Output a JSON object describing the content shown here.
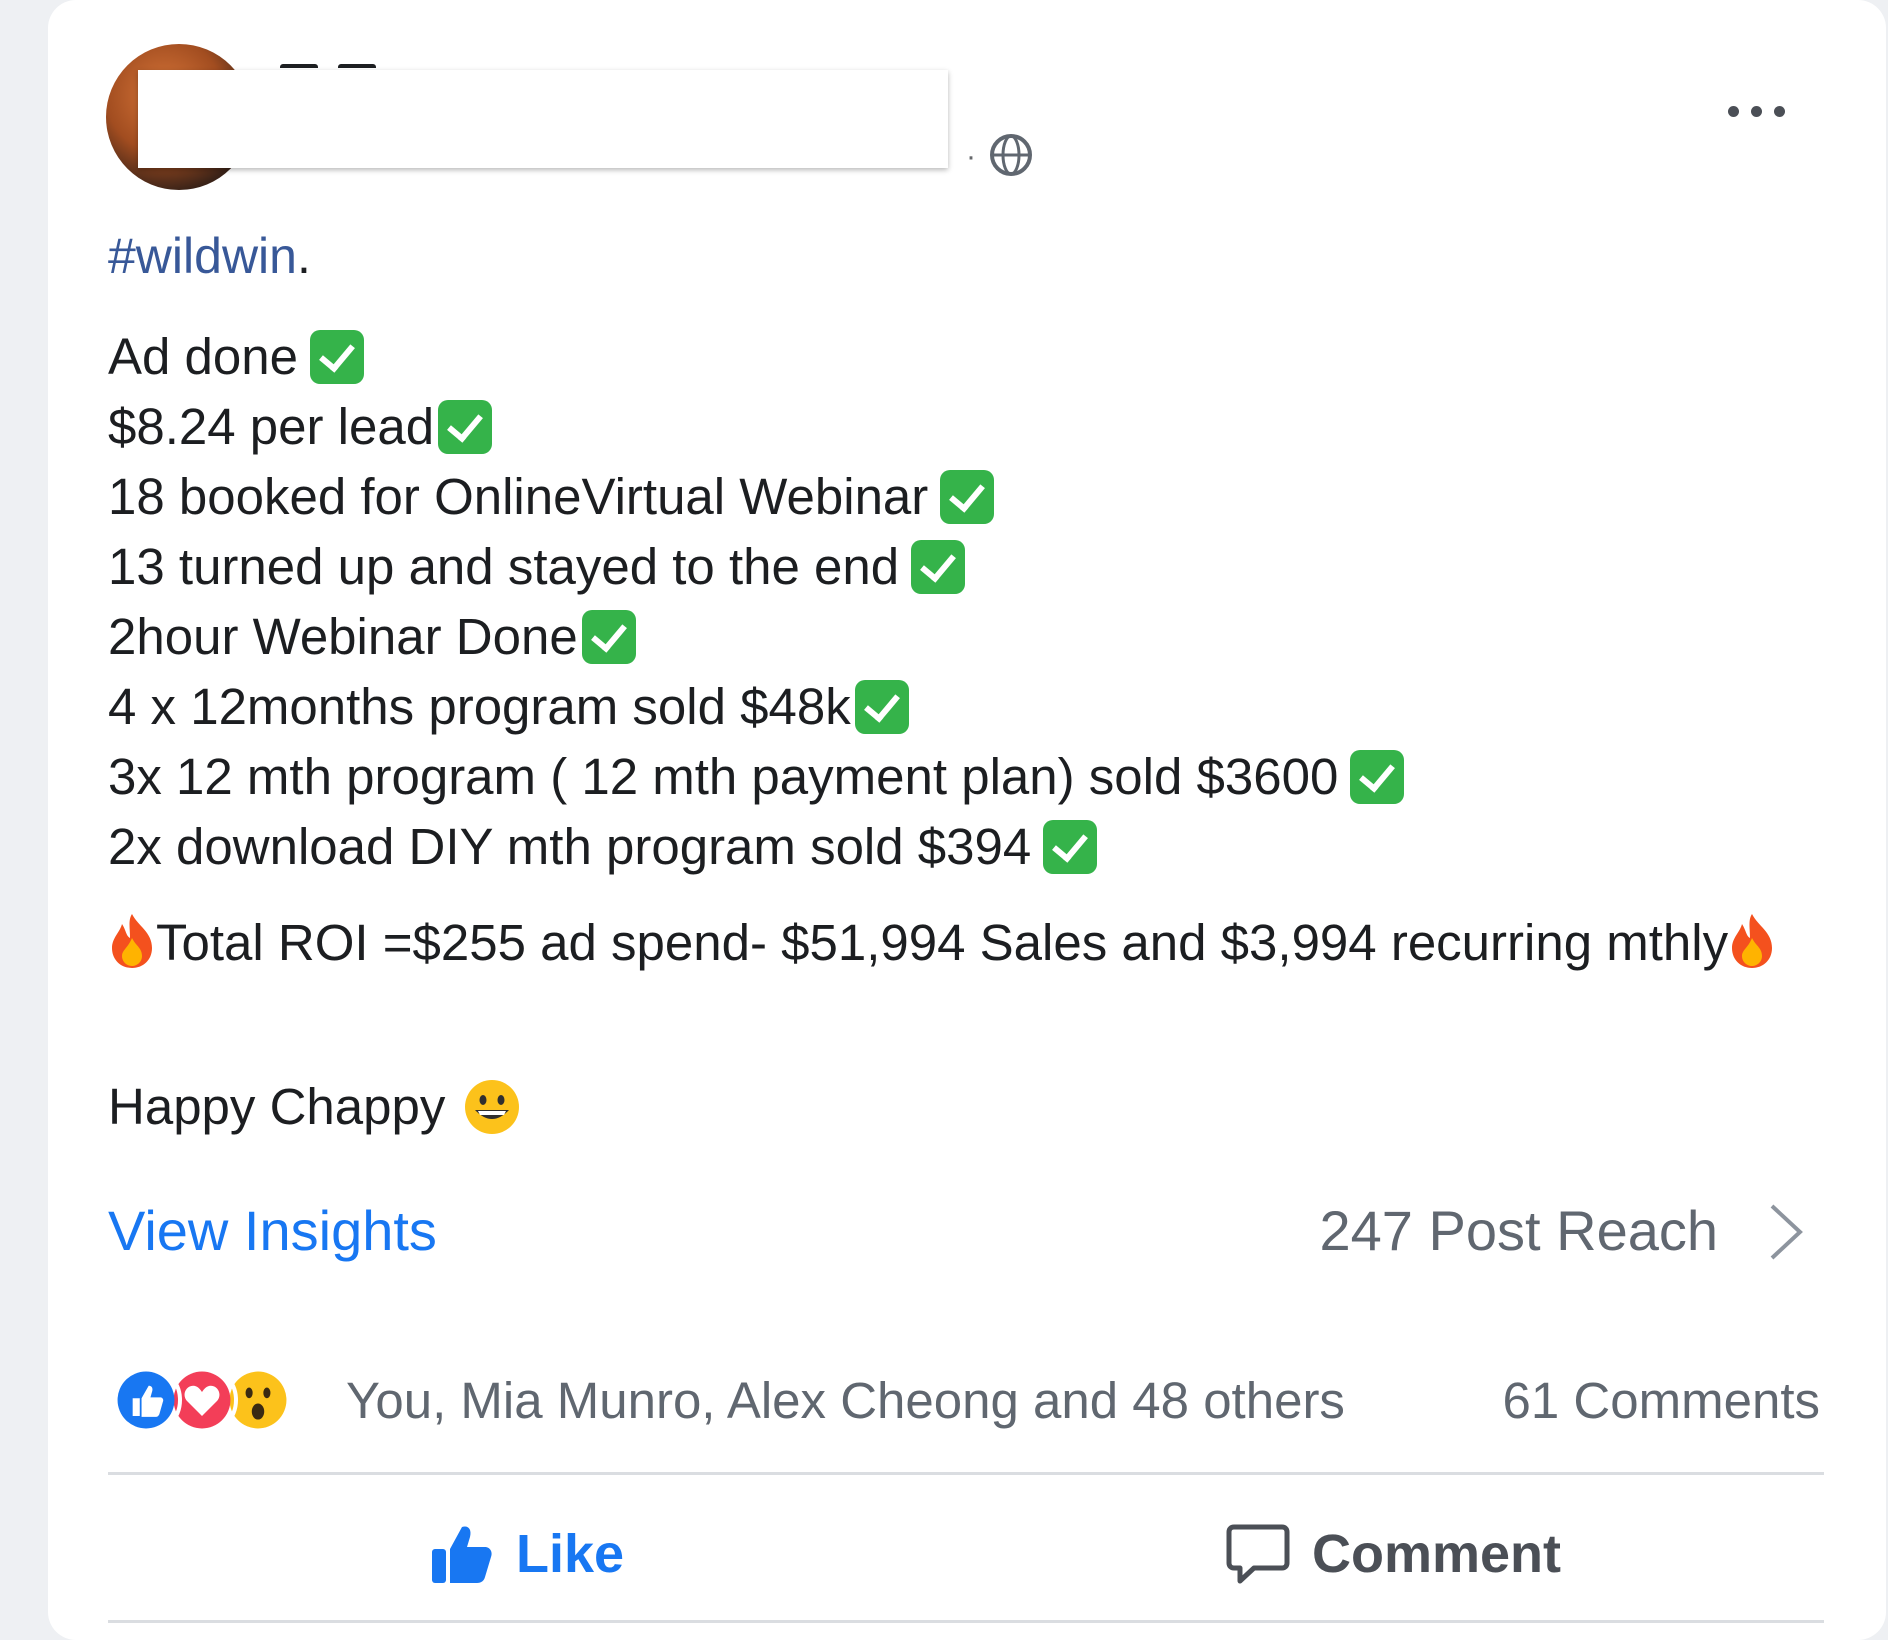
{
  "post": {
    "hashtag": "#wildwin",
    "hashtag_suffix": ".",
    "lines": [
      "Ad done ",
      "$8.24 per lead",
      "18 booked for OnlineVirtual Webinar ",
      "13 turned up and stayed to the end ",
      "2hour Webinar Done",
      "4 x 12months program sold $48k",
      "3x 12 mth program ( 12 mth payment plan) sold $3600 ",
      "2x download DIY mth program sold $394 "
    ],
    "roi_text": "Total ROI =$255 ad spend- $51,994 Sales and $3,994 recurring mthly",
    "closing_text": "Happy Chappy "
  },
  "insights": {
    "link_label": "View Insights",
    "reach_label": "247 Post Reach"
  },
  "reactions": {
    "text": "You, Mia Munro, Alex Cheong and 48 others",
    "comments": "61 Comments",
    "icons": [
      "like-reaction-icon",
      "love-reaction-icon",
      "wow-reaction-icon"
    ]
  },
  "actions": {
    "like_label": "Like",
    "comment_label": "Comment"
  },
  "colors": {
    "link": "#1877f2",
    "hashtag": "#385898",
    "check": "#35b34a",
    "muted": "#606770"
  }
}
